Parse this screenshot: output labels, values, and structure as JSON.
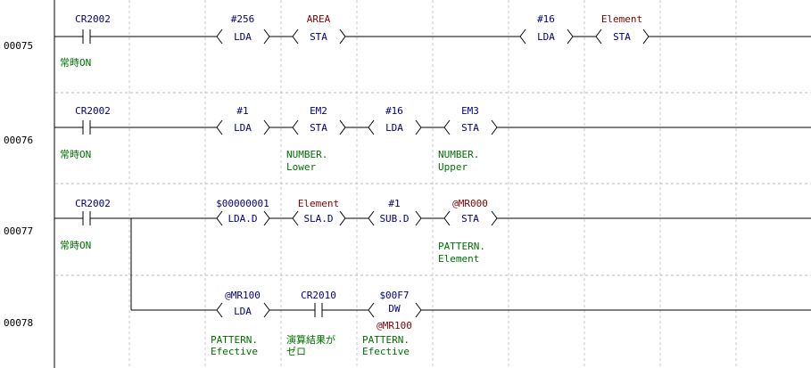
{
  "rungs": [
    {
      "number": "00075",
      "contact": {
        "device": "CR2002",
        "comment": "常時ON"
      },
      "instructions": [
        {
          "op": "LDA",
          "operand": "#256"
        },
        {
          "op": "STA",
          "operand": "AREA"
        },
        {
          "op": "LDA",
          "operand": "#16"
        },
        {
          "op": "STA",
          "operand": "Element"
        }
      ]
    },
    {
      "number": "00076",
      "contact": {
        "device": "CR2002",
        "comment": "常時ON"
      },
      "instructions": [
        {
          "op": "LDA",
          "operand": "#1"
        },
        {
          "op": "STA",
          "operand": "EM2",
          "comment": [
            "NUMBER.",
            "Lower"
          ]
        },
        {
          "op": "LDA",
          "operand": "#16"
        },
        {
          "op": "STA",
          "operand": "EM3",
          "comment": [
            "NUMBER.",
            "Upper"
          ]
        }
      ]
    },
    {
      "number": "00077",
      "contact": {
        "device": "CR2002",
        "comment": "常時ON"
      },
      "instructions": [
        {
          "op": "LDA.D",
          "operand": "$00000001"
        },
        {
          "op": "SLA.D",
          "operand": "Element"
        },
        {
          "op": "SUB.D",
          "operand": "#1"
        },
        {
          "op": "STA",
          "operand": "@MR000",
          "comment": [
            "PATTERN.",
            "Element"
          ]
        }
      ]
    },
    {
      "number": "00078",
      "instructions": [
        {
          "op": "LDA",
          "operand": "@MR100",
          "comment": [
            "PATTERN.",
            "Efective"
          ]
        },
        {
          "contact": "CR2010",
          "comment": [
            "演算結果が",
            "ゼロ"
          ]
        },
        {
          "op": "DW",
          "operand": "$00F7",
          "operand2": "@MR100",
          "comment": [
            "PATTERN.",
            "Efective"
          ]
        }
      ]
    }
  ]
}
